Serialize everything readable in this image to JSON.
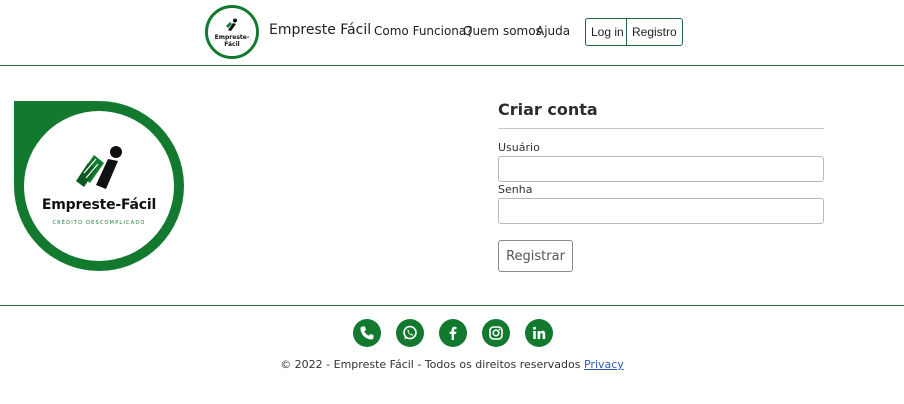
{
  "navbar": {
    "logo_text": "Empreste-Fácil",
    "brand": "Empreste Fácil",
    "links": [
      {
        "label": "Como Funciona?"
      },
      {
        "label": "Quem somos"
      },
      {
        "label": "Ajuda"
      }
    ],
    "login_label": "Log in",
    "register_label": "Registro"
  },
  "hero_logo": {
    "title": "Empreste-Fácil",
    "tagline": "CRÉDITO DESCOMPLICADO"
  },
  "form": {
    "title": "Criar conta",
    "username_label": "Usuário",
    "username_value": "",
    "password_label": "Senha",
    "password_value": "",
    "submit_label": "Registrar"
  },
  "footer": {
    "social_icons": [
      "phone-icon",
      "whatsapp-icon",
      "facebook-icon",
      "instagram-icon",
      "linkedin-icon"
    ],
    "copyright": "© 2022 - Empreste Fácil - Todos os direitos reservados",
    "privacy_label": "Privacy"
  },
  "colors": {
    "brand_green": "#12792f",
    "link_blue": "#2a5db0"
  }
}
